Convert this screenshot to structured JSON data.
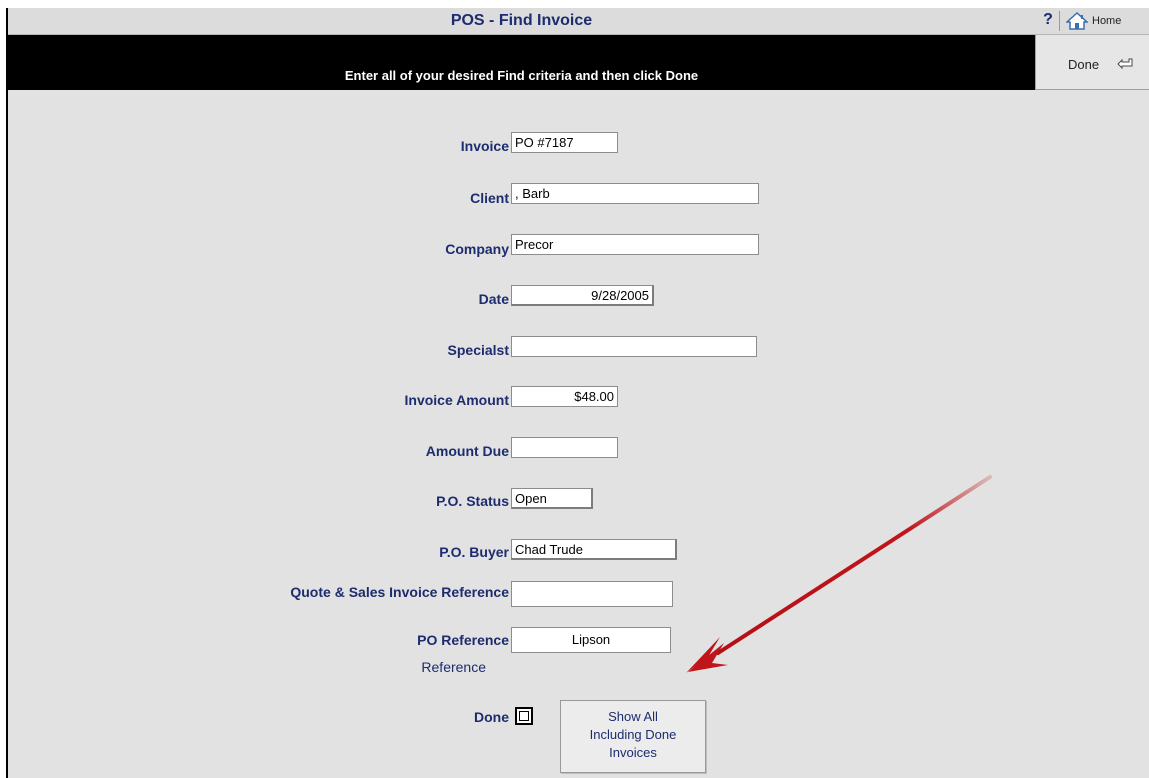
{
  "window": {
    "title": "POS - Find Invoice",
    "help_label": "?",
    "home_label": "Home"
  },
  "banner": {
    "message": "Enter all of your desired Find criteria and then click Done",
    "done_label": "Done"
  },
  "form": {
    "invoice": {
      "label": "Invoice",
      "value": "PO #7187"
    },
    "client": {
      "label": "Client",
      "value": ", Barb"
    },
    "company": {
      "label": "Company",
      "value": "Precor"
    },
    "date": {
      "label": "Date",
      "value": "9/28/2005"
    },
    "specialist": {
      "label": "Specialst",
      "value": ""
    },
    "invoice_amount": {
      "label": "Invoice Amount",
      "value": "$48.00"
    },
    "amount_due": {
      "label": "Amount Due",
      "value": ""
    },
    "po_status": {
      "label": "P.O. Status",
      "value": "Open"
    },
    "po_buyer": {
      "label": "P.O. Buyer",
      "value": "Chad Trude"
    },
    "quote_ref": {
      "label": "Quote & Sales Invoice Reference",
      "value": ""
    },
    "po_reference": {
      "label": "PO Reference",
      "sublabel": "Reference",
      "value": "Lipson"
    },
    "done": {
      "label": "Done",
      "checked": false
    },
    "show_all_button": {
      "line1": "Show All",
      "line2": "Including Done",
      "line3": "Invoices"
    }
  },
  "annotation": {
    "arrow_color": "#c0151b"
  },
  "colors": {
    "label_blue": "#1c2c6e",
    "banner_bg": "#000000",
    "panel_bg": "#e2e2e2"
  }
}
